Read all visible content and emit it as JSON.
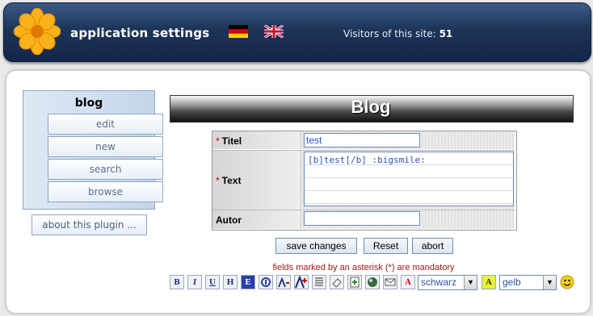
{
  "header": {
    "app_title": "application settings",
    "visitors_label": "Visitors of this site:",
    "visitors_count": "51",
    "languages": [
      "de",
      "en"
    ]
  },
  "sidebar": {
    "title": "blog",
    "items": [
      {
        "label": "edit"
      },
      {
        "label": "new"
      },
      {
        "label": "search"
      },
      {
        "label": "browse"
      }
    ],
    "about_label": "about this plugin ..."
  },
  "main": {
    "heading": "Blog",
    "form": {
      "titel_label": "Titel",
      "titel_value": "test",
      "text_label": "Text",
      "text_value": "[b]test[/b] :bigsmile:",
      "autor_label": "Autor",
      "autor_value": "",
      "required_marker": "*"
    },
    "actions": {
      "save_label": "save changes",
      "reset_label": "Reset",
      "abort_label": "abort"
    },
    "mandatory_note": "fields marked by an asterisk (*) are mandatory",
    "toolbar": {
      "buttons": [
        "bold",
        "italic",
        "underline",
        "heading",
        "emphasis",
        "link",
        "font-size-down",
        "font-size-up",
        "list",
        "eraser",
        "plus",
        "image",
        "mail",
        "text-color"
      ],
      "glyphs": {
        "bold": "B",
        "italic": "I",
        "underline": "U",
        "heading": "H",
        "emphasis": "E",
        "text_color": "A",
        "highlight": "A"
      },
      "color_select": "schwarz",
      "bg_color_select": "gelb"
    }
  },
  "colors": {
    "header_bg": "#1d3458",
    "accent_blue": "#6a8cb8",
    "mandatory_red": "#a01818"
  }
}
